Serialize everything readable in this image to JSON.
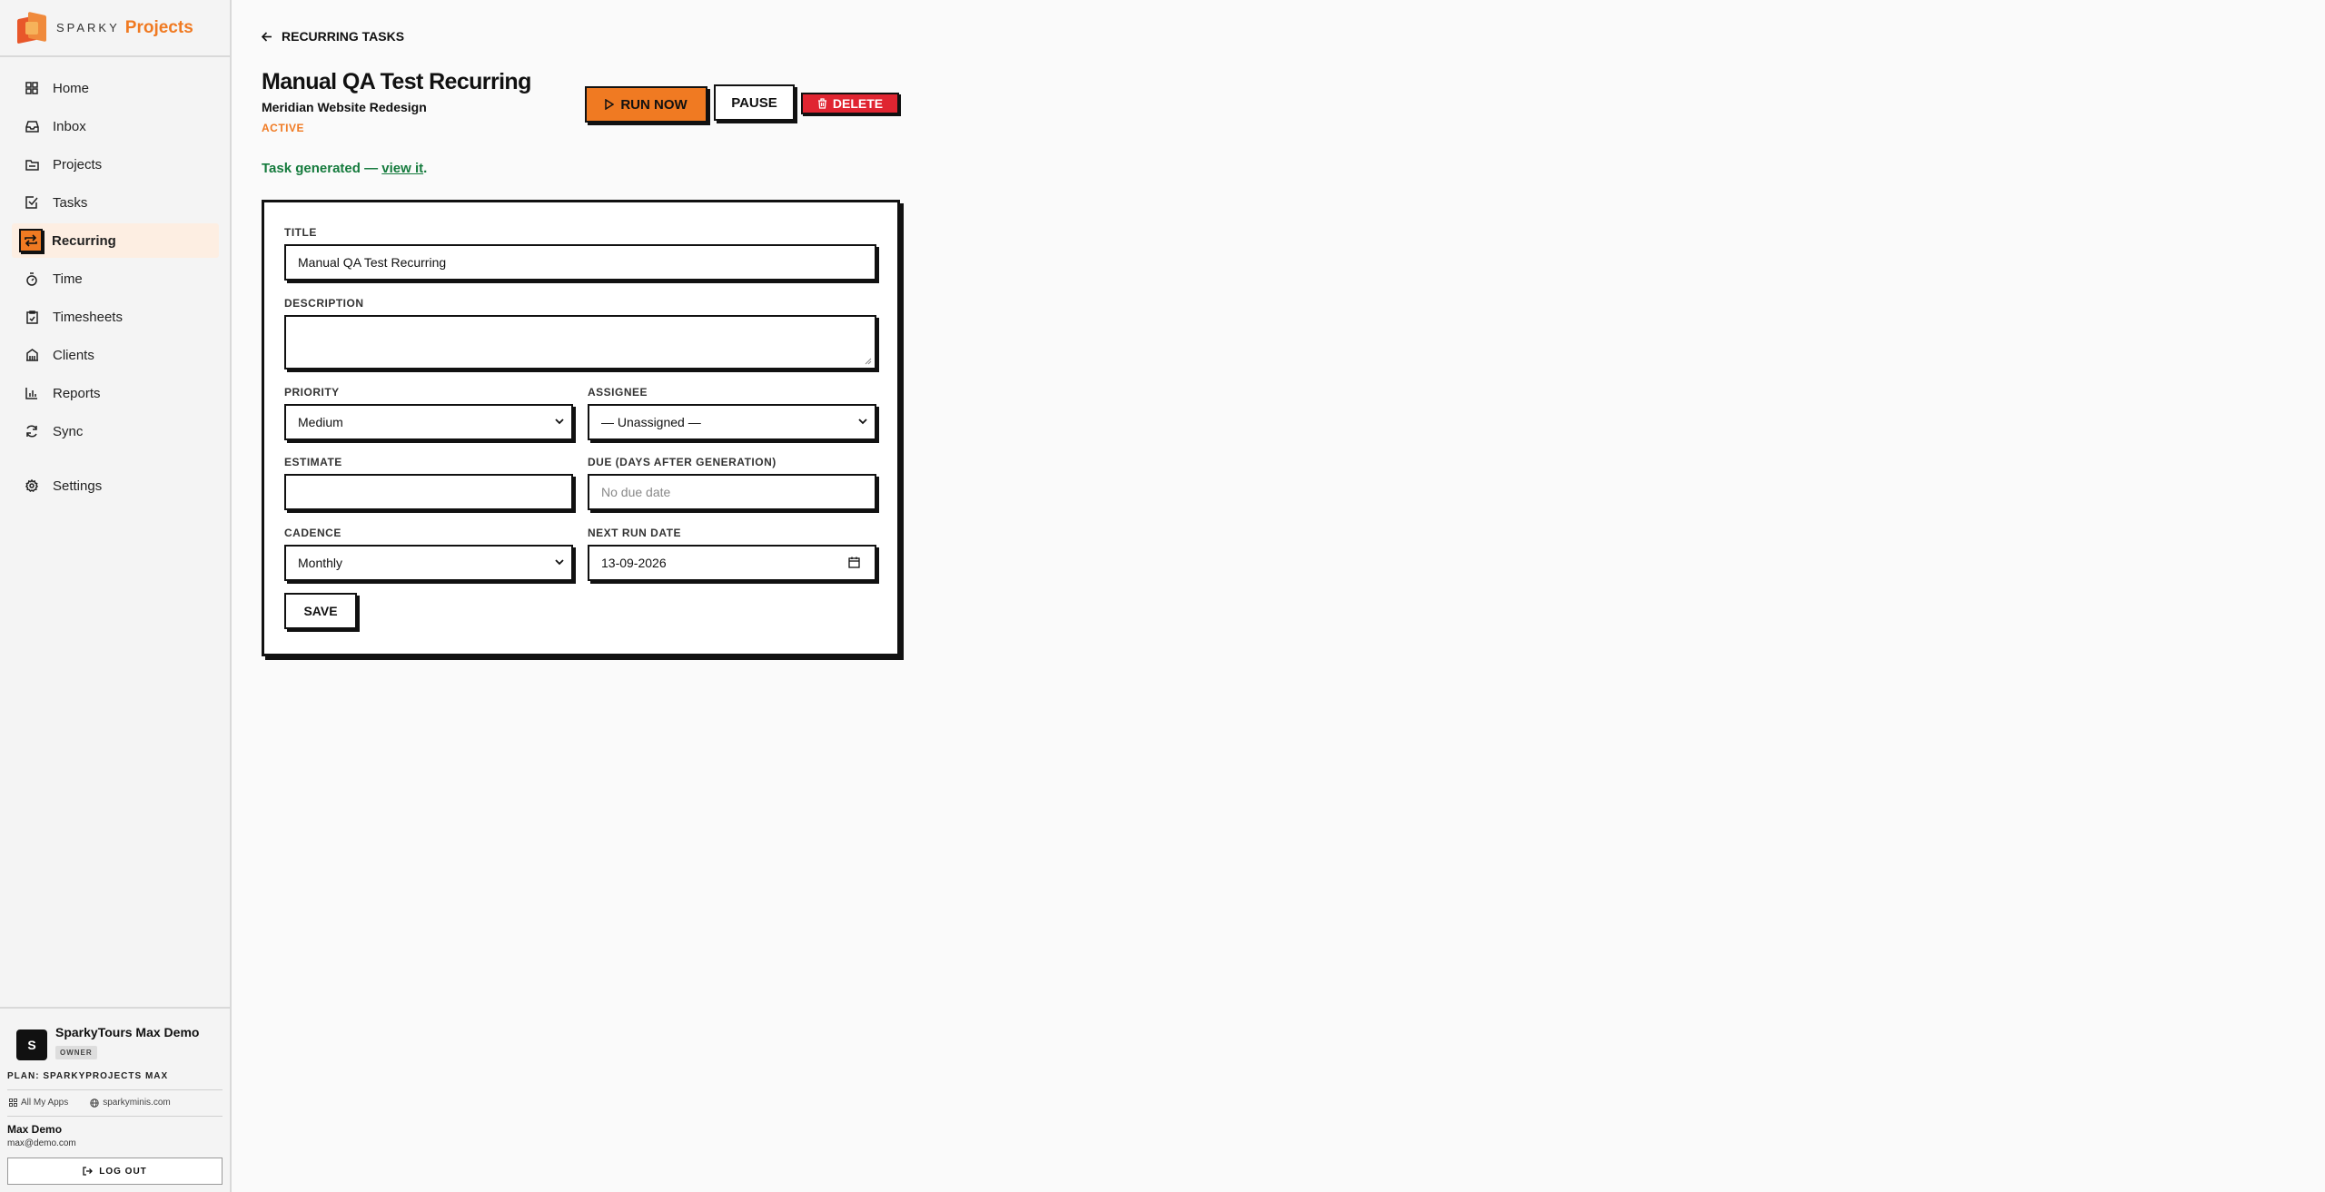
{
  "brand": {
    "sparky": "SPARKY",
    "projects": "Projects"
  },
  "nav": [
    {
      "label": "Home",
      "icon": "home-icon"
    },
    {
      "label": "Inbox",
      "icon": "inbox-icon"
    },
    {
      "label": "Projects",
      "icon": "folder-icon"
    },
    {
      "label": "Tasks",
      "icon": "checkbox-icon"
    },
    {
      "label": "Recurring",
      "icon": "repeat-icon",
      "active": true
    },
    {
      "label": "Time",
      "icon": "stopwatch-icon"
    },
    {
      "label": "Timesheets",
      "icon": "clipboard-check-icon"
    },
    {
      "label": "Clients",
      "icon": "building-icon"
    },
    {
      "label": "Reports",
      "icon": "bar-chart-icon"
    },
    {
      "label": "Sync",
      "icon": "refresh-icon"
    },
    {
      "label": "Settings",
      "icon": "gear-icon"
    }
  ],
  "account": {
    "avatar": "S",
    "org_name": "SparkyTours Max Demo",
    "role": "OWNER",
    "plan": "PLAN: SPARKYPROJECTS MAX",
    "all_apps": "All My Apps",
    "site": "sparkyminis.com",
    "user_name": "Max Demo",
    "user_email": "max@demo.com",
    "logout": "LOG OUT"
  },
  "header": {
    "back": "RECURRING TASKS",
    "title": "Manual QA Test Recurring",
    "project": "Meridian Website Redesign",
    "status": "ACTIVE",
    "run_now": "RUN NOW",
    "pause": "PAUSE",
    "delete": "DELETE"
  },
  "notice": {
    "prefix": "Task generated — ",
    "link": "view it",
    "suffix": "."
  },
  "form": {
    "title_label": "TITLE",
    "title_value": "Manual QA Test Recurring",
    "description_label": "DESCRIPTION",
    "description_value": "",
    "priority_label": "PRIORITY",
    "priority_value": "Medium",
    "assignee_label": "ASSIGNEE",
    "assignee_value": "— Unassigned —",
    "estimate_label": "ESTIMATE",
    "estimate_value": "",
    "due_label": "DUE (DAYS AFTER GENERATION)",
    "due_placeholder": "No due date",
    "cadence_label": "CADENCE",
    "cadence_value": "Monthly",
    "next_run_label": "NEXT RUN DATE",
    "next_run_value": "13-09-2026",
    "save": "SAVE"
  },
  "colors": {
    "accent": "#f07a22",
    "danger": "#e02531",
    "success": "#147a3c",
    "active_bg": "#fdeee2"
  }
}
